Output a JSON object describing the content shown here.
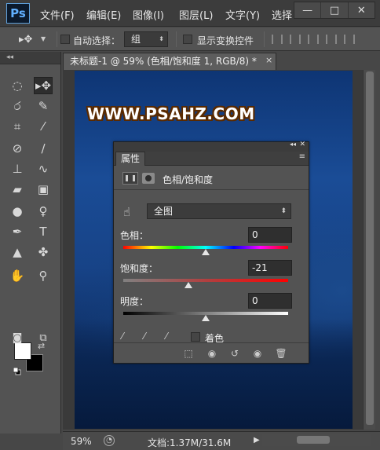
{
  "app": {
    "logo_text": "Ps",
    "menu": [
      "文件(F)",
      "编辑(E)",
      "图像(I)",
      "图层(L)",
      "文字(Y)",
      "选择"
    ],
    "window_controls": {
      "minimize": "—",
      "maximize": "□",
      "close": "✕"
    }
  },
  "options": {
    "tool_icon": "move-tool-icon",
    "auto_select_label": "自动选择：",
    "auto_select_checked": false,
    "auto_select_target": "组",
    "show_transform_label": "显示变换控件",
    "show_transform_checked": false
  },
  "toolbar": {
    "header_glyph": "◂◂",
    "tools": [
      "rectangular-marquee-icon",
      "move-icon",
      "lasso-icon",
      "quick-selection-icon",
      "crop-icon",
      "eyedropper-icon",
      "spot-healing-icon",
      "brush-icon",
      "clone-stamp-icon",
      "history-brush-icon",
      "eraser-icon",
      "gradient-icon",
      "blur-icon",
      "dodge-icon",
      "pen-icon",
      "type-icon",
      "path-selection-icon",
      "custom-shape-icon",
      "hand-icon",
      "zoom-icon"
    ],
    "foreground_color": "#ffffff",
    "background_color": "#000000"
  },
  "document": {
    "tab_title": "未标题-1 @ 59% (色相/饱和度 1, RGB/8) *",
    "close_glyph": "×",
    "watermark": "WWW.PSAHZ.COM"
  },
  "status": {
    "zoom": "59%",
    "doc_info": "文档:1.37M/31.6M"
  },
  "properties_panel": {
    "tab_label": "属性",
    "collapse_glyph": "◂◂",
    "close_glyph": "✕",
    "menu_glyph": "≡",
    "adjustment_title": "色相/饱和度",
    "preset": "全图",
    "hue": {
      "label": "色相：",
      "value": "0",
      "fraction": 0.5
    },
    "saturation": {
      "label": "饱和度：",
      "value": "-21",
      "fraction": 0.395
    },
    "lightness": {
      "label": "明度：",
      "value": "0",
      "fraction": 0.5
    },
    "colorize_label": "着色",
    "colorize_checked": false,
    "footer_icons": [
      "clip-to-layer-icon",
      "view-previous-icon",
      "reset-icon",
      "visibility-eye-icon",
      "delete-icon"
    ]
  }
}
